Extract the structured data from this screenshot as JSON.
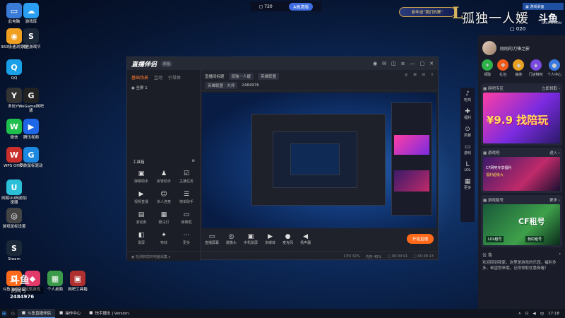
{
  "desktop_icons": [
    {
      "label": "此电脑",
      "glyph": "▭",
      "color": "#3b7bd8"
    },
    {
      "label": "游戏库",
      "glyph": "☁",
      "color": "#2a9ff2"
    },
    {
      "label": "360极速浏览器",
      "glyph": "◉",
      "color": "#f0a020"
    },
    {
      "label": "次进游戏平",
      "glyph": "S",
      "color": "#1b2838"
    },
    {
      "label": "QQ",
      "glyph": "Q",
      "color": "#1aa0e8"
    },
    {
      "label": "多玩YY",
      "glyph": "Y",
      "color": "#333333"
    },
    {
      "label": "WeGame网吧版",
      "glyph": "G",
      "color": "#222222"
    },
    {
      "label": "微信",
      "glyph": "W",
      "color": "#1ebf4c"
    },
    {
      "label": "腾讯视频",
      "glyph": "▶",
      "color": "#1e66e6"
    },
    {
      "label": "WPS Office",
      "glyph": "W",
      "color": "#c9302c"
    },
    {
      "label": "罗技鼠标驱动",
      "glyph": "G",
      "color": "#1c88e0"
    },
    {
      "label": "网易UU网游加速器",
      "glyph": "U",
      "color": "#2bc0d8"
    },
    {
      "label": "游戏鼠标设置",
      "glyph": "◎",
      "color": "#444444"
    },
    {
      "label": "Steam",
      "glyph": "S",
      "color": "#1b2838"
    },
    {
      "label": "斗鱼直播伴侣",
      "glyph": "D",
      "color": "#ff6a1a"
    },
    {
      "label": "战旗游戏",
      "glyph": "◆",
      "color": "#e23b6a"
    },
    {
      "label": "个人桌面",
      "glyph": "▦",
      "color": "#3a9a4a"
    },
    {
      "label": "网吧工具箱",
      "glyph": "▣",
      "color": "#b03030"
    }
  ],
  "top_bar": {
    "left_label": "▢ 720",
    "button": "A高清版"
  },
  "overlay": {
    "banner": "新年送“我们的赛”",
    "stream_name": "孤独一人媛",
    "platform": "斗鱼",
    "platform_url": "DOUYU.COM",
    "fans": "▢ 020"
  },
  "right_panel": {
    "desk_label": "▦ 游戏桌面",
    "profile_name": "刚刚的刀锋之影",
    "quick_items": [
      {
        "label": "领取",
        "glyph": "✦",
        "color": "#2db34a"
      },
      {
        "label": "礼包",
        "glyph": "✚",
        "color": "#f05a1a"
      },
      {
        "label": "抽奖",
        "glyph": "◆",
        "color": "#e8a020"
      },
      {
        "label": "门店特权",
        "glyph": "◈",
        "color": "#7a4ae0"
      },
      {
        "label": "个人中心",
        "glyph": "●",
        "color": "#3a7ae0"
      }
    ],
    "card1": {
      "title": "▦ 网吧专区",
      "more": "立即领取 ›",
      "headline": "¥9.9 找陪玩"
    },
    "card2": {
      "title": "▦ 游戏吧",
      "more": "进入 ›",
      "line1": "CF网吧专享福利",
      "line2": "福利超级大"
    },
    "card3": {
      "title": "▦ 游戏租号",
      "more": "更多 ›",
      "headline": "CF租号",
      "sub1": "LOL租号",
      "sub2": "我的租号"
    },
    "announce_title": "公 告",
    "announce_more": "›",
    "announce_body": "欢迎回到我家，这里是游戏的乐园，福利多多，希望常来哦，记得领取优惠券喔！"
  },
  "side_strip": [
    {
      "label": "吃鸡",
      "glyph": "♪"
    },
    {
      "label": "福利",
      "glyph": "✚"
    },
    {
      "label": "风暴",
      "glyph": "⊙"
    },
    {
      "label": "游戏",
      "glyph": "▭"
    },
    {
      "label": "LOL",
      "glyph": "L"
    },
    {
      "label": "更多",
      "glyph": "▦"
    }
  ],
  "app": {
    "logo": "直播伴侣",
    "version": "新版",
    "tabs": [
      "基础场景",
      "互动",
      "引导体"
    ],
    "scene": "◉ 全屏 1",
    "tools_title": "工具箱",
    "tools": [
      {
        "label": "弹幕助手",
        "glyph": "▣"
      },
      {
        "label": "房管助手",
        "glyph": "♟"
      },
      {
        "label": "主播任务",
        "glyph": "☑"
      },
      {
        "label": "视频直播",
        "glyph": "▶"
      },
      {
        "label": "多人连麦",
        "glyph": "☺"
      },
      {
        "label": "榜单助手",
        "glyph": "☰"
      },
      {
        "label": "滚动条",
        "glyph": "▤"
      },
      {
        "label": "跑马灯",
        "glyph": "▦"
      },
      {
        "label": "弹幕框",
        "glyph": "▭"
      },
      {
        "label": "录屏",
        "glyph": "◧"
      },
      {
        "label": "特效",
        "glyph": "✦"
      },
      {
        "label": "更多",
        "glyph": "⋯"
      }
    ],
    "footer_left": "◉ 检测到您的电脑采集 v",
    "stream_title_label": "直播间标题",
    "stream_title_value": "孤独一人媛",
    "category_label": "英雄联盟",
    "room_label": "英雄联盟 · 大师",
    "room_id": "2484976",
    "header_actions": [
      "◎",
      "⊞",
      "⊟",
      "⇪"
    ],
    "toolbar": [
      {
        "label": "直播屏幕",
        "glyph": "▭"
      },
      {
        "label": "摄像头",
        "glyph": "◎"
      },
      {
        "label": "手机投屏",
        "glyph": "▣"
      },
      {
        "label": "多媒体",
        "glyph": "▶"
      },
      {
        "label": "麦克风",
        "glyph": "●"
      },
      {
        "label": "扬声器",
        "glyph": "◀"
      }
    ],
    "start_button": "开始直播",
    "status": [
      "CPU 32%",
      "内存 45%",
      "▢ 00:00:01",
      "▢ 00:00:13"
    ]
  },
  "room_box": {
    "big": "斗鱼",
    "label": "房间号",
    "number": "2484976"
  },
  "taskbar": {
    "tasks": [
      {
        "label": "斗鱼直播伴侣",
        "active": true
      },
      {
        "label": "操作中心",
        "active": false
      },
      {
        "label": "快手播出 | Version:",
        "active": false
      }
    ],
    "tray": [
      "∧",
      "⊡",
      "◀",
      "中",
      "17:18"
    ]
  }
}
